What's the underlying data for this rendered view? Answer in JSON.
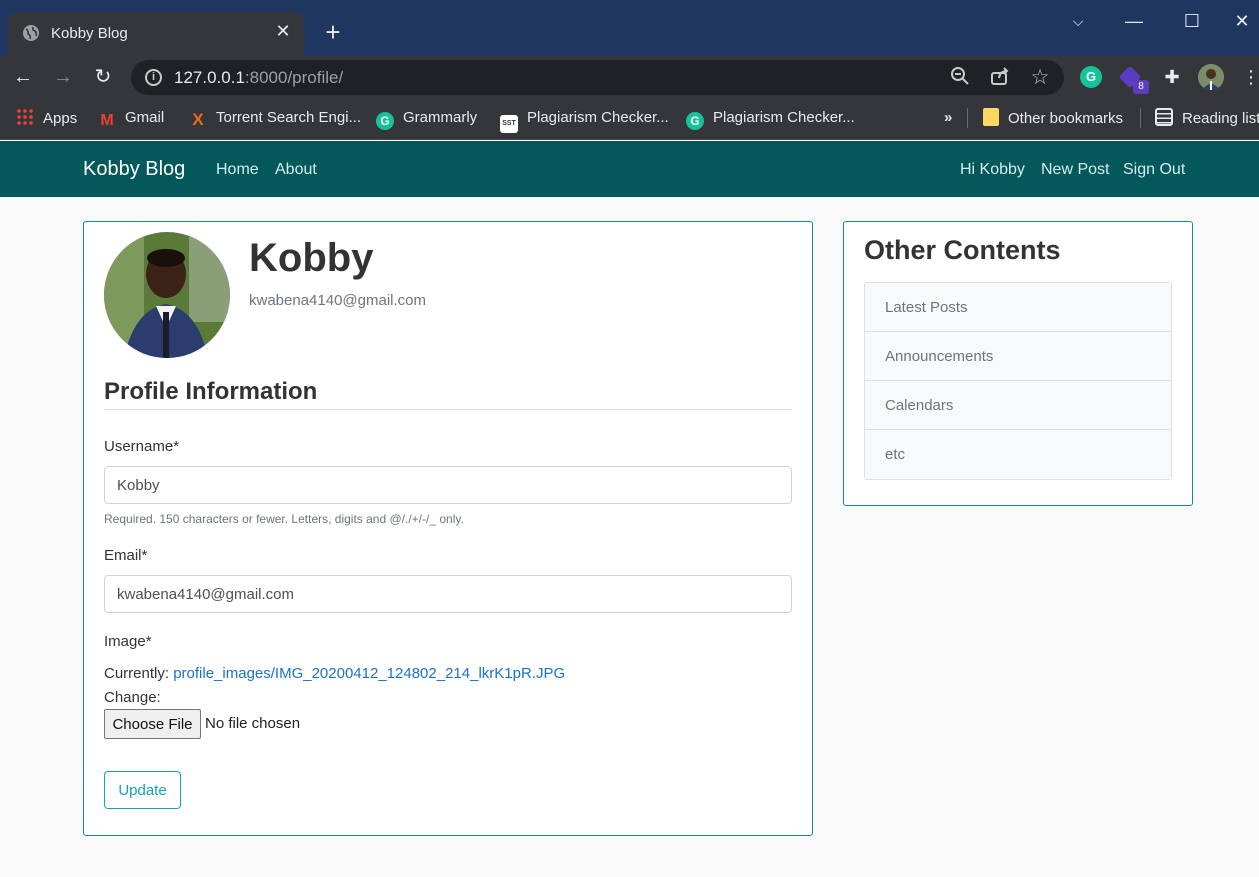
{
  "browser": {
    "tab_title": "Kobby Blog",
    "url_host": "127.0.0.1",
    "url_rest": ":8000/profile/",
    "extension_badge": "8",
    "bookmarks": [
      "Apps",
      "Gmail",
      "Torrent Search Engi...",
      "Grammarly",
      "Plagiarism Checker...",
      "Plagiarism Checker...",
      "»",
      "Other bookmarks",
      "Reading list"
    ]
  },
  "navbar": {
    "brand": "Kobby Blog",
    "left_links": [
      "Home",
      "About"
    ],
    "right_links": [
      "Hi Kobby",
      "New Post",
      "Sign Out"
    ],
    "color": "#03585c"
  },
  "profile": {
    "name": "Kobby",
    "email": "kwabena4140@gmail.com",
    "section_title": "Profile Information",
    "username_label": "Username*",
    "username_value": "Kobby",
    "username_help": "Required. 150 characters or fewer. Letters, digits and @/./+/-/_ only.",
    "email_label": "Email*",
    "email_value": "kwabena4140@gmail.com",
    "image_label": "Image*",
    "currently_label": "Currently:",
    "current_file": "profile_images/IMG_20200412_124802_214_lkrK1pR.JPG",
    "change_label": "Change:",
    "choose_file": "Choose File",
    "no_file": "No file chosen",
    "update_button": "Update"
  },
  "sidebar": {
    "title": "Other Contents",
    "items": [
      "Latest Posts",
      "Announcements",
      "Calendars",
      "etc"
    ]
  }
}
